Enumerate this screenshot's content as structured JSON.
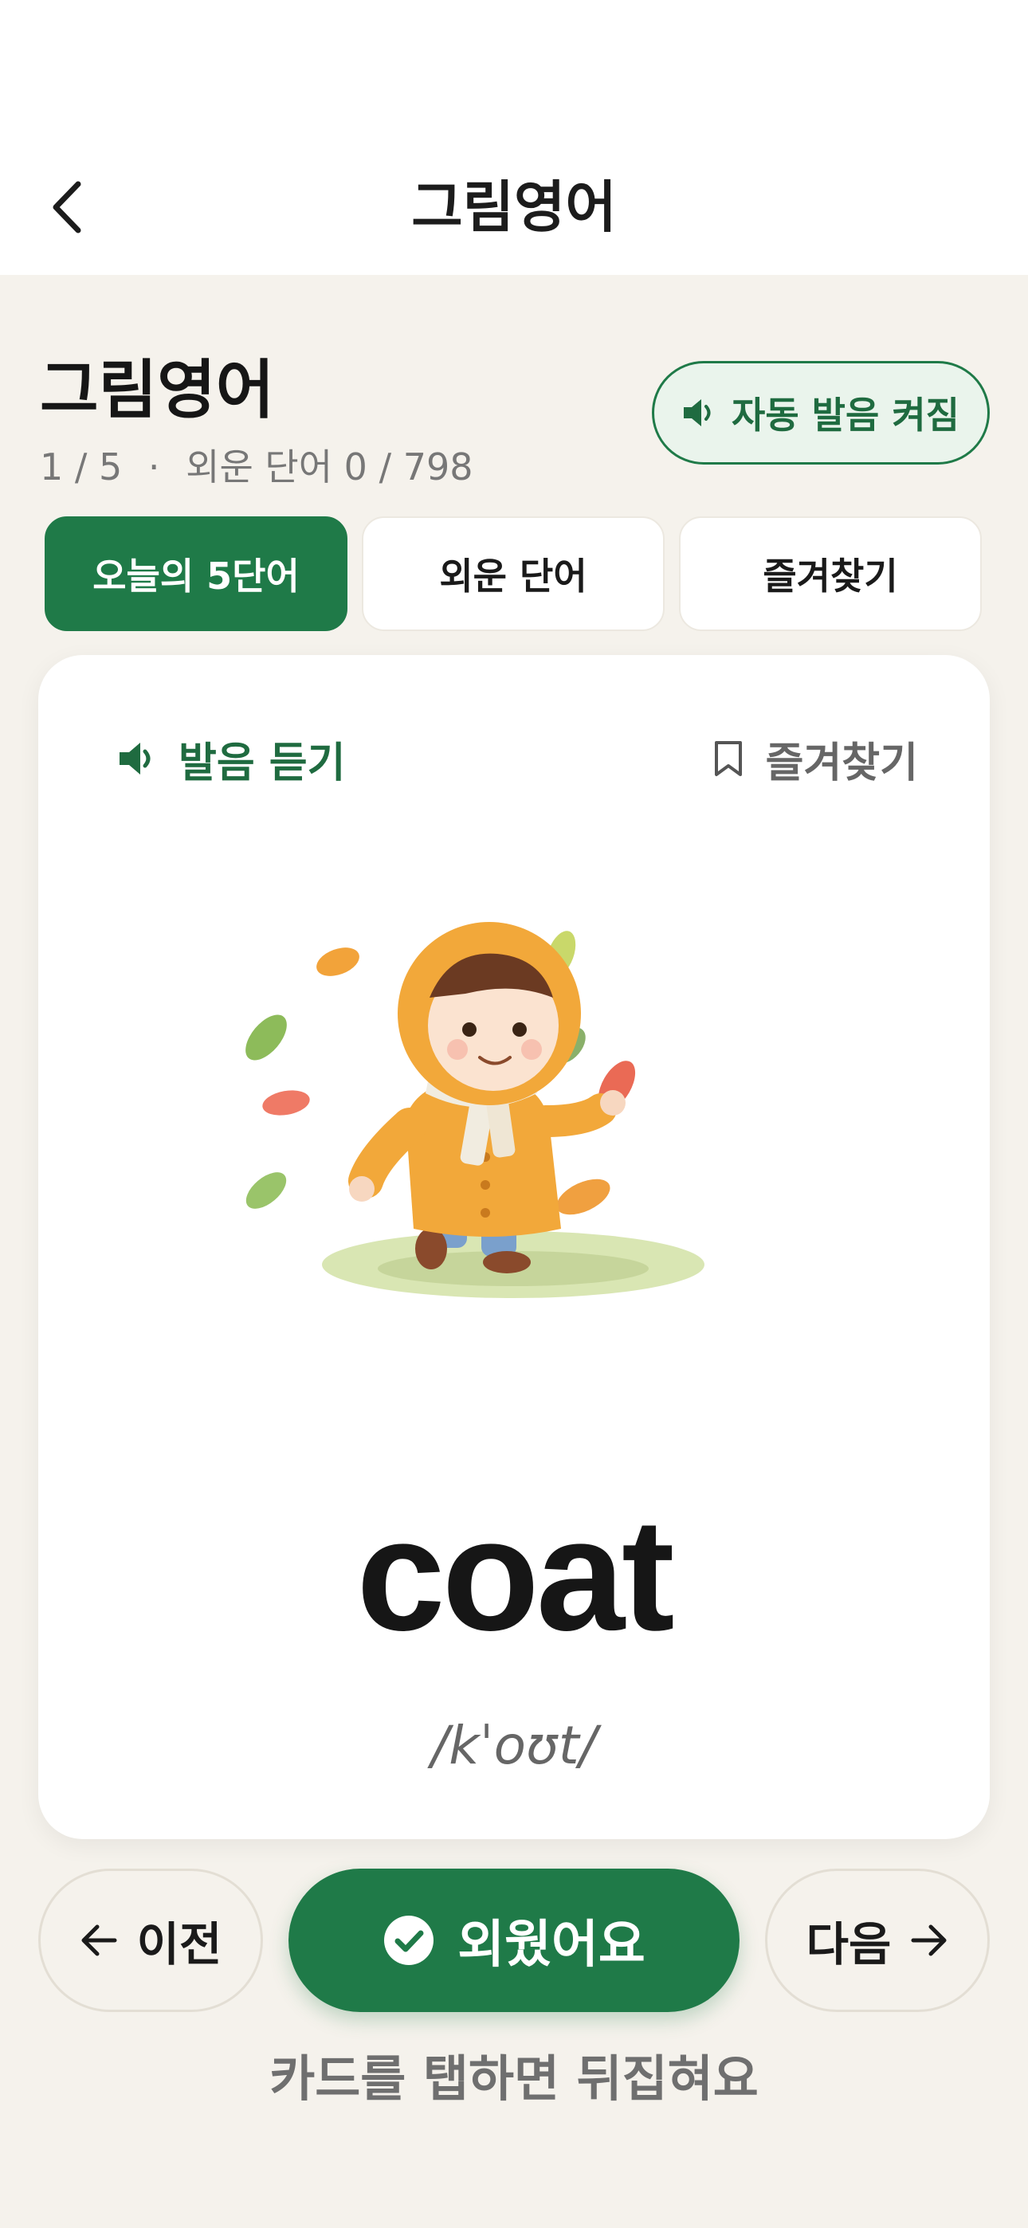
{
  "header": {
    "title": "그림영어"
  },
  "section": {
    "heading": "그림영어",
    "progress": "1 / 5",
    "separator": "·",
    "memorized": "외운 단어 0 / 798"
  },
  "auto_pronounce": {
    "label": "자동 발음 켜짐",
    "enabled": true
  },
  "tabs": [
    {
      "label": "오늘의 5단어",
      "active": true
    },
    {
      "label": "외운 단어",
      "active": false
    },
    {
      "label": "즐겨찾기",
      "active": false
    }
  ],
  "card": {
    "listen_label": "발음 듣기",
    "bookmark_label": "즐겨찾기",
    "word": "coat",
    "phonetic": "/kˈoʊt/"
  },
  "controls": {
    "prev_label": "이전",
    "done_label": "외웠어요",
    "next_label": "다음"
  },
  "hint": "카드를 탭하면 뒤집혀요",
  "colors": {
    "accent": "#1f7a48",
    "background": "#f5f2ec"
  }
}
